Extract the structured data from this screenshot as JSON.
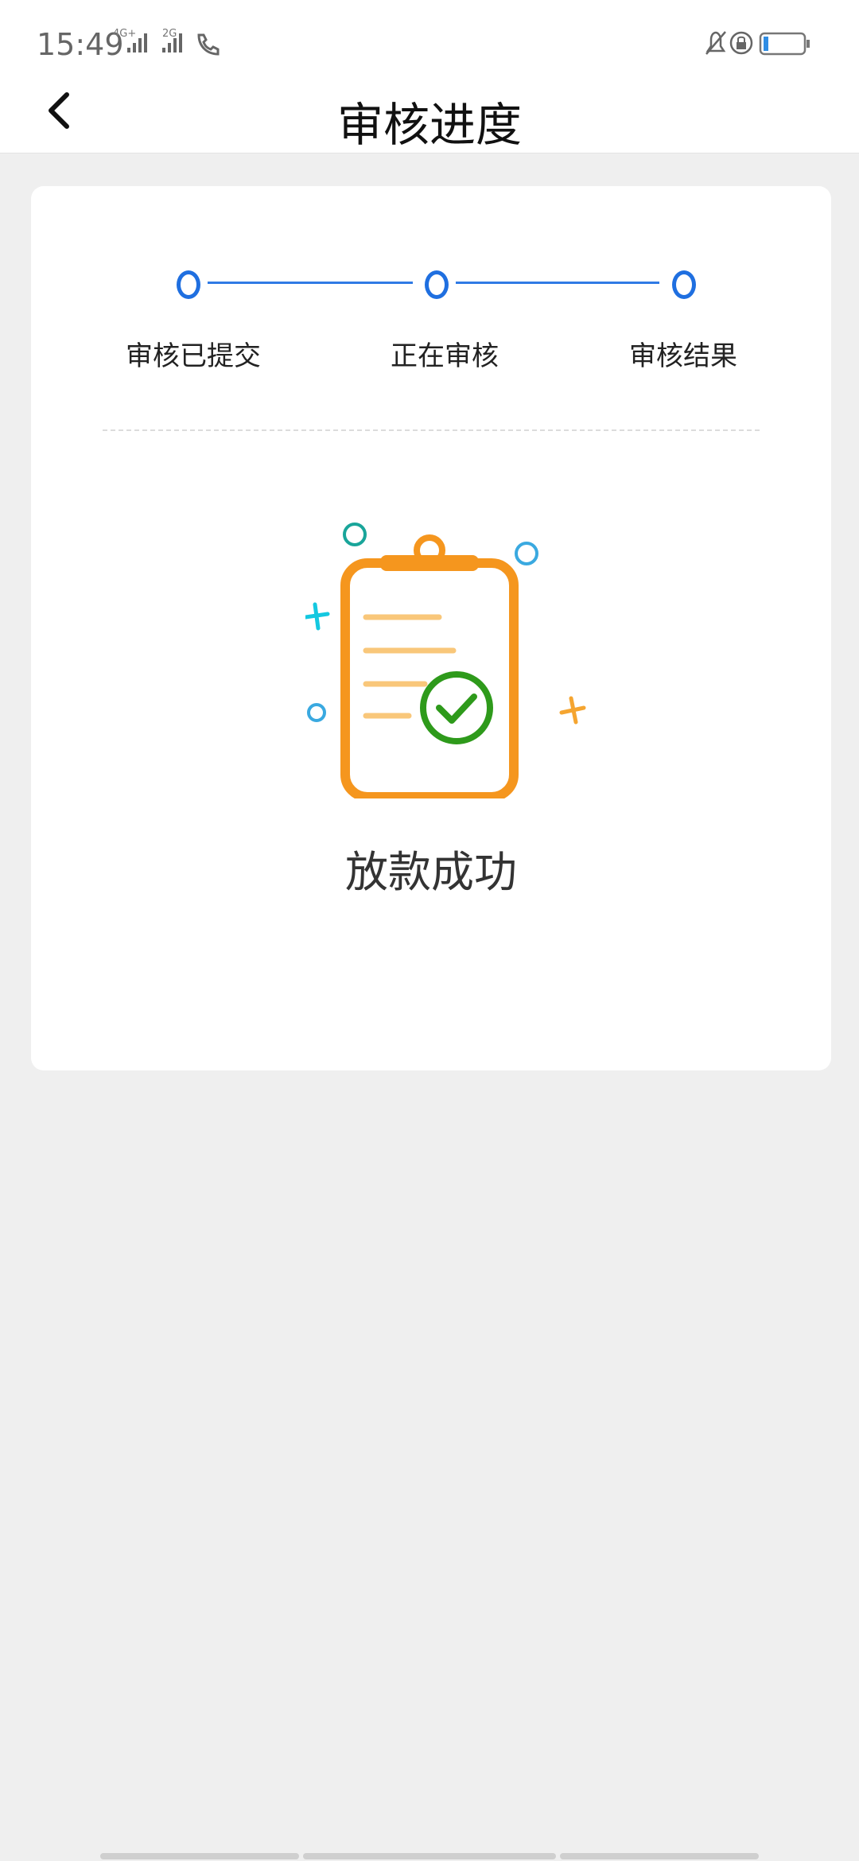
{
  "status_bar": {
    "time": "15:49",
    "network_1": "4G+",
    "network_2": "2G"
  },
  "header": {
    "title": "审核进度"
  },
  "steps": [
    {
      "label": "审核已提交"
    },
    {
      "label": "正在审核"
    },
    {
      "label": "审核结果"
    }
  ],
  "result": {
    "text": "放款成功"
  },
  "colors": {
    "accent": "#1f6fe0",
    "clipboard": "#f5961e",
    "check": "#2e9a1b",
    "background": "#efefef"
  },
  "icons": {
    "back": "chevron-left-icon",
    "clipboard": "clipboard-check-icon"
  }
}
